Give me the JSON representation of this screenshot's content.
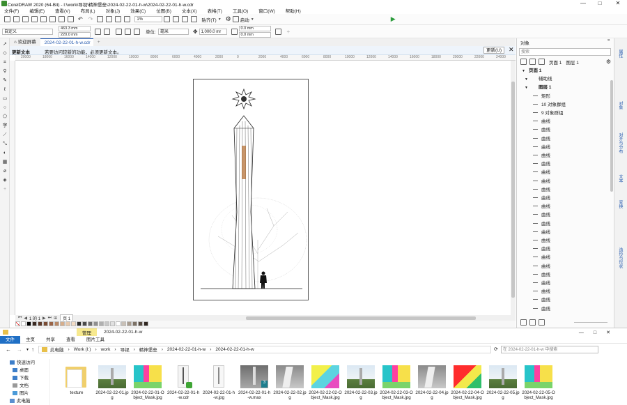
{
  "window": {
    "title": "CorelDRAW 2020 (64-Bit) - I:\\work\\导视\\精神堡垒\\2024-02-22-01-h-w\\2024-02-22-01-h-w.cdr",
    "controls": [
      "—",
      "□",
      "✕"
    ]
  },
  "menu": [
    "文件(F)",
    "编辑(E)",
    "查看(V)",
    "布局(L)",
    "对象(J)",
    "效果(C)",
    "位图(B)",
    "文本(X)",
    "表格(T)",
    "工具(O)",
    "窗口(W)",
    "帮助(H)"
  ],
  "toolbar": {
    "zoom": "1%",
    "snap_label": "贴齐(T)",
    "launch_label": "启动"
  },
  "propbar": {
    "preset": "自定义",
    "width": "463.3 mm",
    "height": "220.0 mm",
    "units_label": "单位:",
    "units": "毫米",
    "nudge": "1,000.0 mr",
    "dup_x": "0.0 mm",
    "dup_y": "0.0 mm"
  },
  "doc_tabs": [
    {
      "label": "欢迎屏幕"
    },
    {
      "label": "2024-02-22-01-h-w.cdr"
    }
  ],
  "notice": {
    "title": "更新文本",
    "message": "若要访问较新的功能，必须更新文本。",
    "button": "更新(U)"
  },
  "ruler": {
    "h_labels": [
      "20000",
      "18000",
      "16000",
      "14000",
      "12000",
      "10000",
      "8000",
      "6000",
      "4000",
      "2000",
      "0",
      "2000",
      "4000",
      "6000",
      "8000",
      "10000",
      "12000",
      "14000",
      "16000",
      "18000",
      "20000",
      "22000",
      "24000"
    ]
  },
  "page_nav": {
    "counter": "1 的 1",
    "page_tab": "页 1"
  },
  "palette_colors": [
    "#ffffff",
    "#000000",
    "#3b2a22",
    "#5c3a2a",
    "#7a4b33",
    "#9a6446",
    "#b98866",
    "#d6ae8c",
    "#e7c9ad",
    "#f2dcc5",
    "#2b2b2b",
    "#4a4a4a",
    "#6d6d6d",
    "#8f8f8f",
    "#b0b0b0",
    "#c8c8c8",
    "#e0e0e0",
    "#ffffff",
    "#c9c0b6",
    "#a89c8f",
    "#7d7266",
    "#54493f",
    "#2f2620"
  ],
  "objects_docker": {
    "title": "对象",
    "search_placeholder": "搜索",
    "page_label": "页面 1",
    "layer_label": "图层 1",
    "tree": [
      {
        "label": "页面 1",
        "indent": 0,
        "bold": true
      },
      {
        "label": "辅助线",
        "indent": 1
      },
      {
        "label": "图层 1",
        "indent": 1,
        "bold": true
      },
      {
        "label": "矩形",
        "indent": 2
      },
      {
        "label": "10 对象群组",
        "indent": 2
      },
      {
        "label": "9 对象群组",
        "indent": 2
      },
      {
        "label": "曲线",
        "indent": 2
      },
      {
        "label": "曲线",
        "indent": 2
      },
      {
        "label": "曲线",
        "indent": 2
      },
      {
        "label": "曲线",
        "indent": 2
      },
      {
        "label": "曲线",
        "indent": 2
      },
      {
        "label": "曲线",
        "indent": 2
      },
      {
        "label": "曲线",
        "indent": 2
      },
      {
        "label": "曲线",
        "indent": 2
      },
      {
        "label": "曲线",
        "indent": 2
      },
      {
        "label": "曲线",
        "indent": 2
      },
      {
        "label": "曲线",
        "indent": 2
      },
      {
        "label": "曲线",
        "indent": 2
      },
      {
        "label": "曲线",
        "indent": 2
      },
      {
        "label": "曲线",
        "indent": 2
      },
      {
        "label": "曲线",
        "indent": 2
      },
      {
        "label": "曲线",
        "indent": 2
      },
      {
        "label": "曲线",
        "indent": 2
      },
      {
        "label": "曲线",
        "indent": 2
      },
      {
        "label": "曲线",
        "indent": 2
      },
      {
        "label": "曲线",
        "indent": 2
      },
      {
        "label": "曲线",
        "indent": 2
      },
      {
        "label": "曲线",
        "indent": 2
      },
      {
        "label": "曲线",
        "indent": 2
      }
    ]
  },
  "side_tabs": [
    "属性",
    "对象",
    "对齐与分布",
    "文本",
    "变换",
    "造形与形状"
  ],
  "explorer": {
    "title": "2024-02-22-01-h-w",
    "manage_tab": "管理",
    "picture_tools": "图片工具",
    "ribbon": [
      "文件",
      "主页",
      "共享",
      "查看",
      "图片工具"
    ],
    "breadcrumbs": [
      "此电脑",
      "Work (I:)",
      "work",
      "导视",
      "精神堡垒",
      "2024-02-22-01-h-w",
      "2024-02-22-01-h-w"
    ],
    "search_placeholder": "在 2024-02-22-01-h-w 中搜索",
    "nav": [
      "快速访问",
      "桌面",
      "下载",
      "文档",
      "图片",
      "此电脑"
    ],
    "files": [
      {
        "name": "texture",
        "kind": "folder"
      },
      {
        "name": "2024-02-22-01.jpg",
        "kind": "photo"
      },
      {
        "name": "2024-02-22-01-Object_Mask.jpg",
        "kind": "mask"
      },
      {
        "name": "2024-02-22-01-h-w.cdr",
        "kind": "cdr"
      },
      {
        "name": "2024-02-22-01-h-w.jpg",
        "kind": "render"
      },
      {
        "name": "2024-02-22-01-h-w.max",
        "kind": "max"
      },
      {
        "name": "2024-02-22-02.jpg",
        "kind": "photo2"
      },
      {
        "name": "2024-02-22-02-Object_Mask.jpg",
        "kind": "mask2"
      },
      {
        "name": "2024-02-22-03.jpg",
        "kind": "photo"
      },
      {
        "name": "2024-02-22-03-Object_Mask.jpg",
        "kind": "mask"
      },
      {
        "name": "2024-02-22-04.jpg",
        "kind": "photo2"
      },
      {
        "name": "2024-02-22-04-Object_Mask.jpg",
        "kind": "mask3"
      },
      {
        "name": "2024-02-22-05.jpg",
        "kind": "photo"
      },
      {
        "name": "2024-02-22-05-Object_Mask.jpg",
        "kind": "mask"
      }
    ]
  }
}
